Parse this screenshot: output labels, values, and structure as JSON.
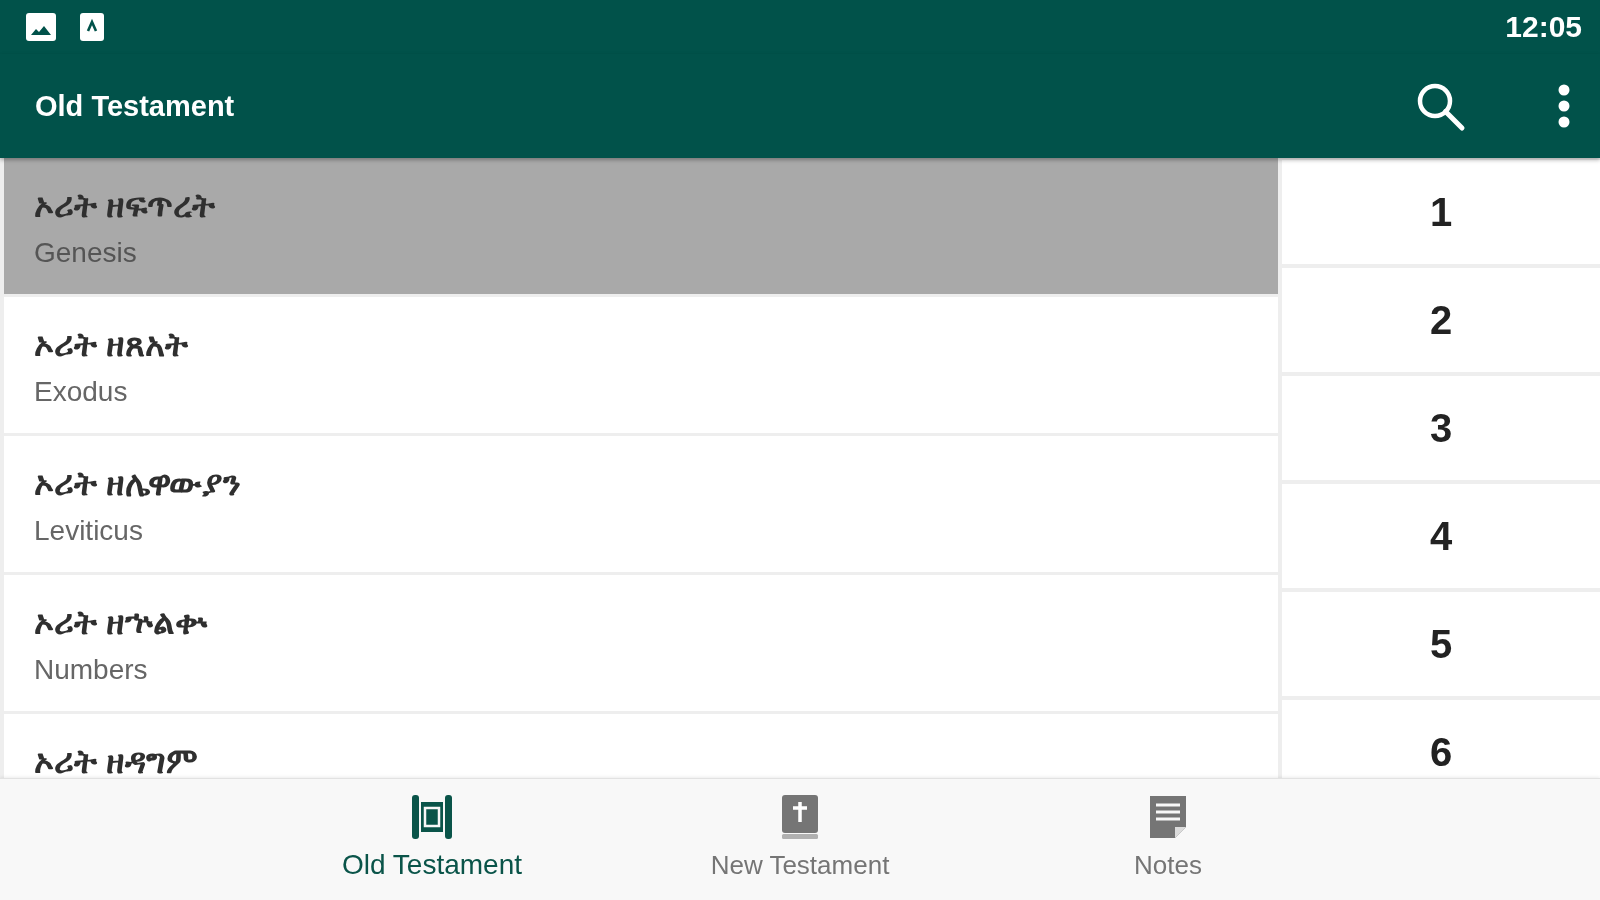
{
  "status_bar": {
    "time": "12:05"
  },
  "app_bar": {
    "title": "Old Testament"
  },
  "books": [
    {
      "name": "ኦሪት ዘፍጥረት",
      "english": "Genesis",
      "selected": true
    },
    {
      "name": "ኦሪት ዘጸአት",
      "english": "Exodus",
      "selected": false
    },
    {
      "name": "ኦሪት ዘሌዋውያን",
      "english": "Leviticus",
      "selected": false
    },
    {
      "name": "ኦሪት ዘኍልቍ",
      "english": "Numbers",
      "selected": false
    },
    {
      "name": "ኦሪት ዘዳግም",
      "selected": false
    }
  ],
  "chapters": [
    "1",
    "2",
    "3",
    "4",
    "5",
    "6"
  ],
  "bottom_nav": [
    {
      "label": "Old Testament",
      "selected": true
    },
    {
      "label": "New Testament",
      "selected": false
    },
    {
      "label": "Notes",
      "selected": false
    }
  ]
}
